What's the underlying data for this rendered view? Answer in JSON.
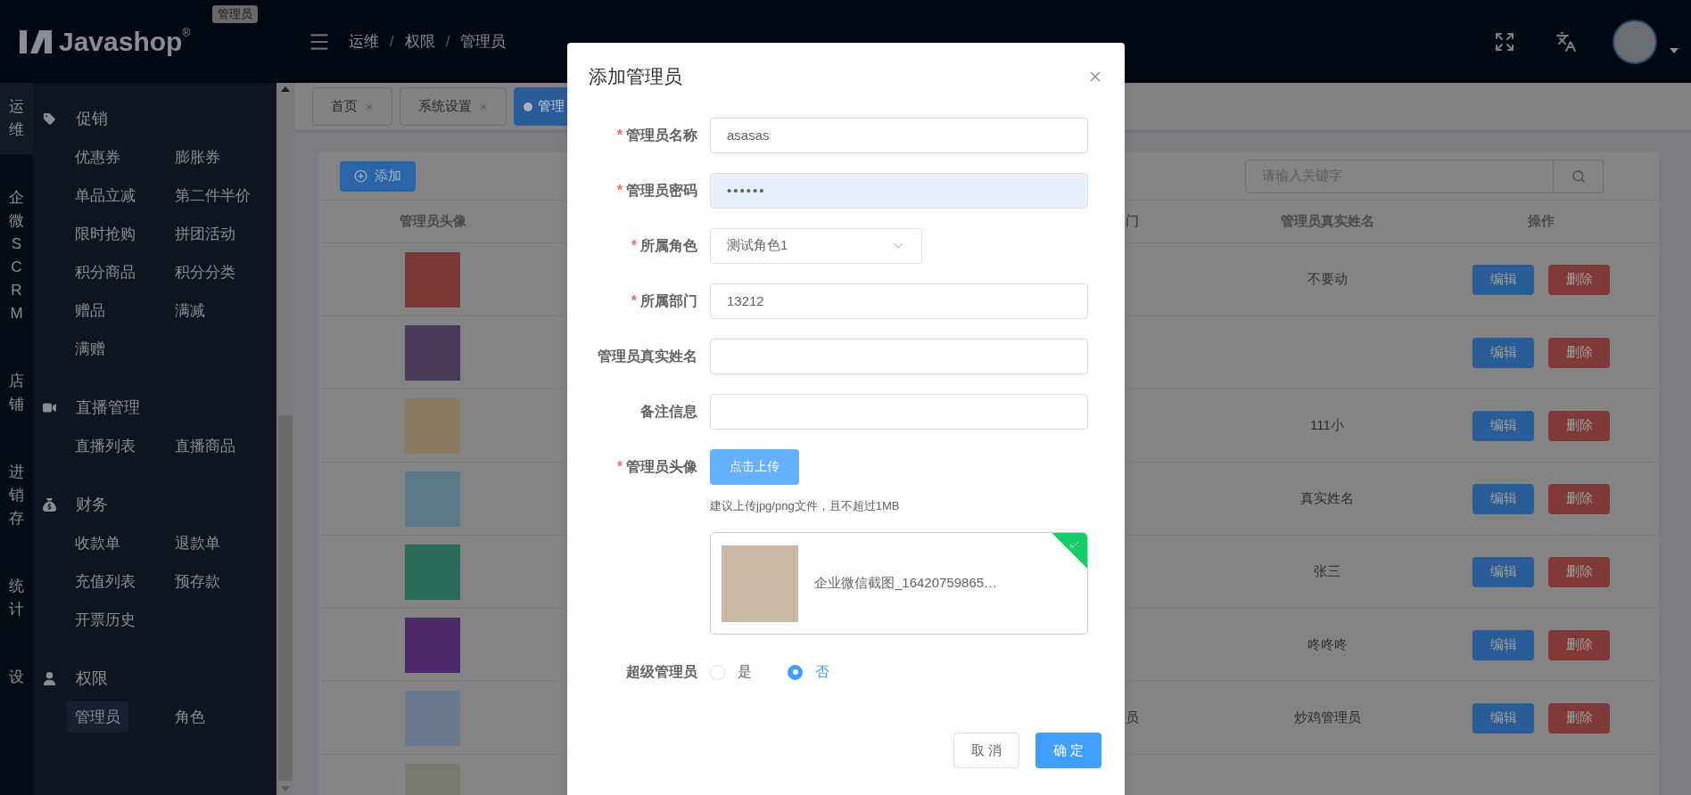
{
  "header": {
    "logo": "Javashop",
    "logo_mark": "®",
    "role_badge": "管理员",
    "breadcrumb": [
      {
        "label": "运维"
      },
      {
        "separator": "/",
        "label": "权限"
      },
      {
        "separator": "/",
        "label": "管理员"
      }
    ]
  },
  "module_nav": [
    {
      "label": "运维",
      "selected": true
    },
    {
      "label": "企微SCRM",
      "selected": false
    },
    {
      "label": "店铺",
      "selected": false
    },
    {
      "label": "进销存",
      "selected": false
    },
    {
      "label": "统计",
      "selected": false
    },
    {
      "label": "设",
      "selected": false
    }
  ],
  "menu": [
    {
      "title": "促销",
      "kind": "tag",
      "items": [
        {
          "label": "优惠券",
          "selected": false
        },
        {
          "label": "膨胀券",
          "selected": false
        },
        {
          "label": "单品立减",
          "selected": false
        },
        {
          "label": "第二件半价",
          "selected": false
        },
        {
          "label": "限时抢购",
          "selected": false
        },
        {
          "label": "拼团活动",
          "selected": false
        },
        {
          "label": "积分商品",
          "selected": false
        },
        {
          "label": "积分分类",
          "selected": false
        },
        {
          "label": "赠品",
          "selected": false
        },
        {
          "label": "满减",
          "selected": false
        },
        {
          "label": "满赠",
          "selected": false
        }
      ]
    },
    {
      "title": "直播管理",
      "kind": "video",
      "items": [
        {
          "label": "直播列表",
          "selected": false
        },
        {
          "label": "直播商品",
          "selected": false
        }
      ]
    },
    {
      "title": "财务",
      "kind": "moneybag",
      "items": [
        {
          "label": "收款单",
          "selected": false
        },
        {
          "label": "退款单",
          "selected": false
        },
        {
          "label": "充值列表",
          "selected": false
        },
        {
          "label": "预存款",
          "selected": false
        },
        {
          "label": "开票历史",
          "selected": false
        }
      ]
    },
    {
      "title": "权限",
      "kind": "user",
      "items": [
        {
          "label": "管理员",
          "selected": true
        },
        {
          "label": "角色",
          "selected": false
        }
      ]
    }
  ],
  "tabs": [
    {
      "label": "首页",
      "selected": false
    },
    {
      "label": "系统设置",
      "selected": false
    },
    {
      "label": "管理",
      "selected": true
    }
  ],
  "toolbar": {
    "add_button": "添加",
    "search": {
      "placeholder": "请输入关键字"
    }
  },
  "table": {
    "columns": [
      "管理员头像",
      "门",
      "管理员真实姓名",
      "操作"
    ],
    "rows": [
      {
        "real_name": "不要动",
        "actions": [
          "编辑",
          "删除"
        ]
      },
      {
        "actions": [
          "编辑",
          "删除"
        ]
      },
      {
        "real_name": "111小",
        "actions": [
          "编辑",
          "删除"
        ]
      },
      {
        "real_name": "真实姓名",
        "actions": [
          "编辑",
          "删除"
        ]
      },
      {
        "real_name": "张三",
        "actions": [
          "编辑",
          "删除"
        ]
      },
      {
        "real_name": "咚咚咚",
        "actions": [
          "编辑",
          "删除"
        ]
      },
      {
        "column_3": "员",
        "real_name": "炒鸡管理员",
        "actions": [
          "编辑",
          "删除"
        ]
      },
      {}
    ]
  },
  "dialog": {
    "title": "添加管理员",
    "fields": [
      {
        "kind": "text",
        "required_mark": "*",
        "label": "管理员名称",
        "value": "asasas"
      },
      {
        "kind": "password",
        "required_mark": "*",
        "label": "管理员密码",
        "value": "••••••"
      },
      {
        "kind": "select",
        "required_mark": "*",
        "label": "所属角色",
        "value": "测试角色1"
      },
      {
        "kind": "text",
        "required_mark": "*",
        "label": "所属部门",
        "value": "13212"
      },
      {
        "kind": "text",
        "label": "管理员真实姓名"
      },
      {
        "kind": "text",
        "label": "备注信息"
      },
      {
        "kind": "upload",
        "required_mark": "*",
        "label": "管理员头像",
        "button": "点击上传",
        "hint": "建议上传jpg/png文件，且不超过1MB",
        "file": {
          "name": "企业微信截图_16420759865…",
          "uploaded": true
        }
      },
      {
        "kind": "radio",
        "label": "超级管理员",
        "options": [
          {
            "label": "是",
            "selected": false
          },
          {
            "label": "否",
            "selected": true
          }
        ]
      }
    ],
    "buttons": [
      {
        "label": "取 消",
        "kind": "default"
      },
      {
        "label": "确 定",
        "kind": "primary"
      }
    ]
  }
}
